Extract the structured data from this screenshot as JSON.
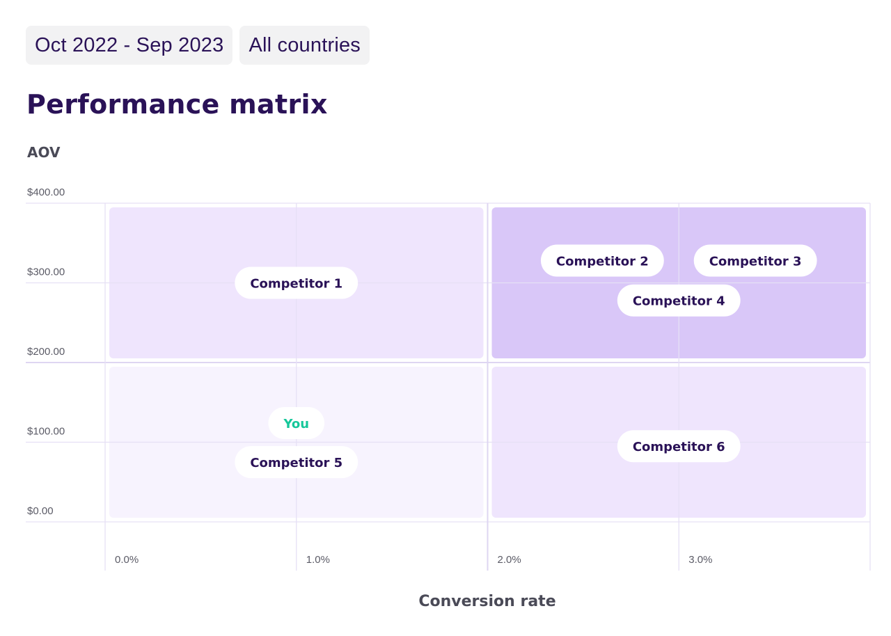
{
  "filters": {
    "date_range": "Oct 2022 - Sep 2023",
    "country": "All countries"
  },
  "page_title": "Performance matrix",
  "chart_data": {
    "type": "scatter",
    "title": "Performance matrix",
    "xlabel": "Conversion rate",
    "ylabel": "AOV",
    "xlim": [
      0,
      4
    ],
    "ylim": [
      0,
      400
    ],
    "x_ticks": [
      {
        "value": 0,
        "label": "0.0%"
      },
      {
        "value": 1,
        "label": "1.0%"
      },
      {
        "value": 2,
        "label": "2.0%"
      },
      {
        "value": 3,
        "label": "3.0%"
      }
    ],
    "y_ticks": [
      {
        "value": 400,
        "label": "$400.00"
      },
      {
        "value": 300,
        "label": "$300.00"
      },
      {
        "value": 200,
        "label": "$200.00"
      },
      {
        "value": 100,
        "label": "$100.00"
      },
      {
        "value": 0,
        "label": "$0.00"
      }
    ],
    "grid": true,
    "quadrants": [
      {
        "name": "low-conversion-high-aov",
        "x": [
          0,
          2
        ],
        "y": [
          200,
          400
        ],
        "color": "#efe5fd"
      },
      {
        "name": "high-conversion-high-aov",
        "x": [
          2,
          4
        ],
        "y": [
          200,
          400
        ],
        "color": "#d9c7f8"
      },
      {
        "name": "low-conversion-low-aov",
        "x": [
          0,
          2
        ],
        "y": [
          0,
          200
        ],
        "color": "#f7f3fe"
      },
      {
        "name": "high-conversion-low-aov",
        "x": [
          2,
          4
        ],
        "y": [
          0,
          200
        ],
        "color": "#efe5fd"
      }
    ],
    "points": [
      {
        "label": "Competitor 1",
        "quadrant": "low-conversion-high-aov",
        "x": 1.0,
        "y": 300,
        "color": "#2a1257"
      },
      {
        "label": "Competitor 2",
        "quadrant": "high-conversion-high-aov",
        "x": 2.6,
        "y": 328,
        "color": "#2a1257"
      },
      {
        "label": "Competitor 3",
        "quadrant": "high-conversion-high-aov",
        "x": 3.4,
        "y": 328,
        "color": "#2a1257"
      },
      {
        "label": "Competitor 4",
        "quadrant": "high-conversion-high-aov",
        "x": 3.0,
        "y": 278,
        "color": "#2a1257"
      },
      {
        "label": "You",
        "quadrant": "low-conversion-low-aov",
        "x": 1.0,
        "y": 124,
        "color": "#16c79a"
      },
      {
        "label": "Competitor 5",
        "quadrant": "low-conversion-low-aov",
        "x": 1.0,
        "y": 75,
        "color": "#2a1257"
      },
      {
        "label": "Competitor 6",
        "quadrant": "high-conversion-low-aov",
        "x": 3.0,
        "y": 95,
        "color": "#2a1257"
      }
    ]
  }
}
